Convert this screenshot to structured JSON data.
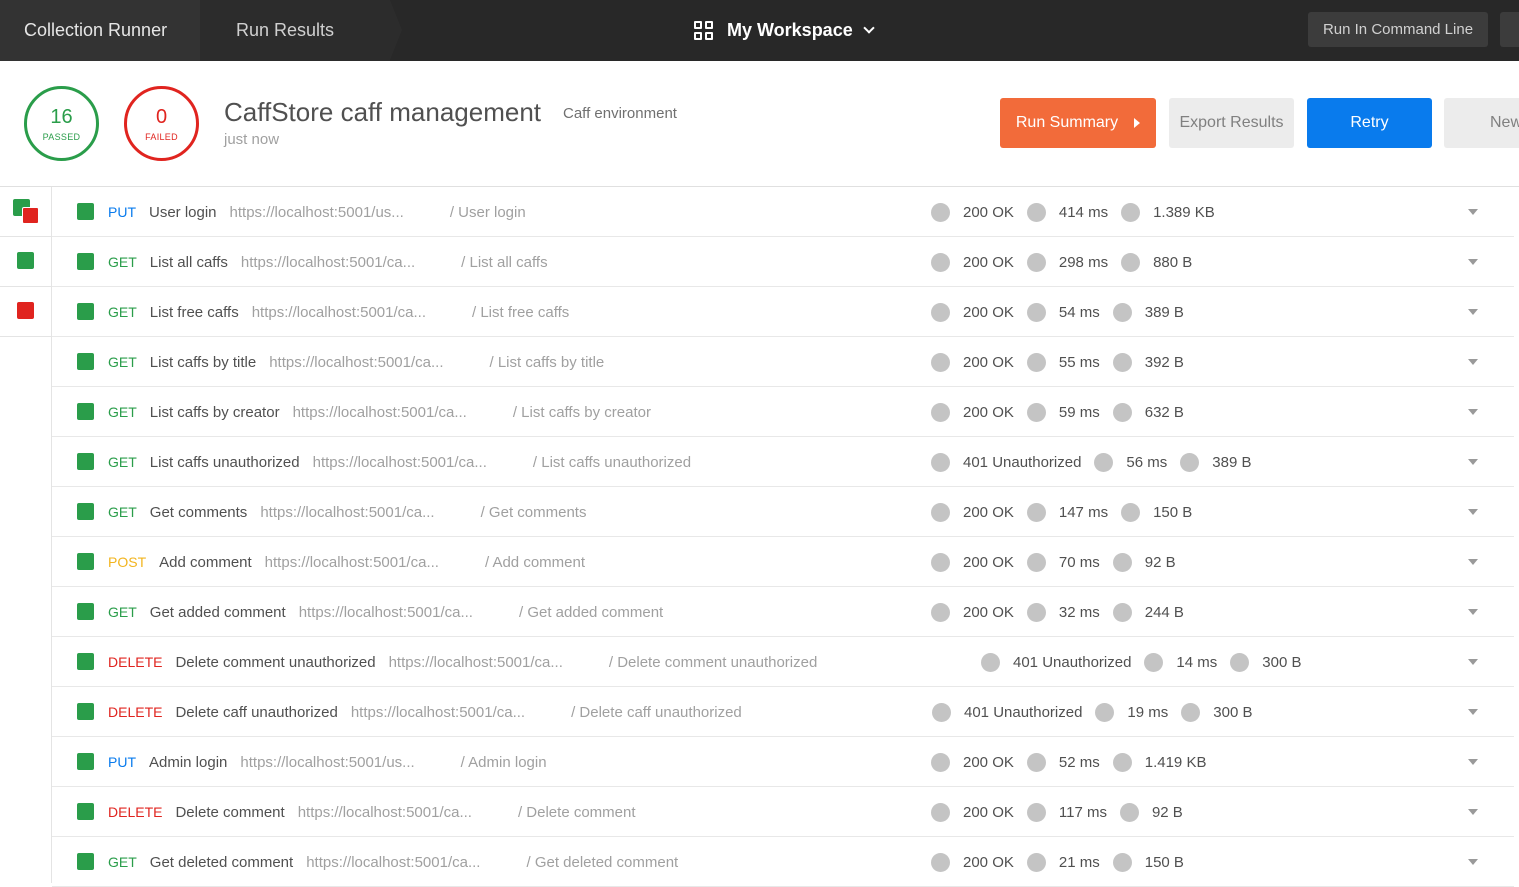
{
  "topbar": {
    "crumb_runner": "Collection Runner",
    "crumb_results": "Run Results",
    "workspace": "My Workspace",
    "run_cli": "Run In Command Line"
  },
  "summary": {
    "passed_count": "16",
    "passed_label": "PASSED",
    "failed_count": "0",
    "failed_label": "FAILED",
    "collection": "CaffStore caff management",
    "environment": "Caff environment",
    "time": "just now",
    "btn_summary": "Run Summary",
    "btn_export": "Export Results",
    "btn_retry": "Retry",
    "btn_new": "New"
  },
  "colors": {
    "pass": "#2a9d4a",
    "fail": "#e0241f",
    "accent_orange": "#f26b3a",
    "accent_blue": "#097bed"
  },
  "requests": [
    {
      "method": "PUT",
      "name": "User login",
      "url": "https://localhost:5001/us...",
      "path": "/ User login",
      "status": "200 OK",
      "time": "414 ms",
      "size": "1.389 KB"
    },
    {
      "method": "GET",
      "name": "List all caffs",
      "url": "https://localhost:5001/ca...",
      "path": "/ List all caffs",
      "status": "200 OK",
      "time": "298 ms",
      "size": "880 B"
    },
    {
      "method": "GET",
      "name": "List free caffs",
      "url": "https://localhost:5001/ca...",
      "path": "/ List free caffs",
      "status": "200 OK",
      "time": "54 ms",
      "size": "389 B"
    },
    {
      "method": "GET",
      "name": "List caffs by title",
      "url": "https://localhost:5001/ca...",
      "path": "/ List caffs by title",
      "status": "200 OK",
      "time": "55 ms",
      "size": "392 B"
    },
    {
      "method": "GET",
      "name": "List caffs by creator",
      "url": "https://localhost:5001/ca...",
      "path": "/ List caffs by creator",
      "status": "200 OK",
      "time": "59 ms",
      "size": "632 B"
    },
    {
      "method": "GET",
      "name": "List caffs unauthorized",
      "url": "https://localhost:5001/ca...",
      "path": "/ List caffs unauthorized",
      "status": "401 Unauthorized",
      "time": "56 ms",
      "size": "389 B"
    },
    {
      "method": "GET",
      "name": "Get comments",
      "url": "https://localhost:5001/ca...",
      "path": "/ Get comments",
      "status": "200 OK",
      "time": "147 ms",
      "size": "150 B"
    },
    {
      "method": "POST",
      "name": "Add comment",
      "url": "https://localhost:5001/ca...",
      "path": "/ Add comment",
      "status": "200 OK",
      "time": "70 ms",
      "size": "92 B"
    },
    {
      "method": "GET",
      "name": "Get added comment",
      "url": "https://localhost:5001/ca...",
      "path": "/ Get added comment",
      "status": "200 OK",
      "time": "32 ms",
      "size": "244 B"
    },
    {
      "method": "DELETE",
      "name": "Delete comment unauthorized",
      "url": "https://localhost:5001/ca...",
      "path": "/ Delete comment unauthorized",
      "status": "401 Unauthorized",
      "time": "14 ms",
      "size": "300 B"
    },
    {
      "method": "DELETE",
      "name": "Delete caff unauthorized",
      "url": "https://localhost:5001/ca...",
      "path": "/ Delete caff unauthorized",
      "status": "401 Unauthorized",
      "time": "19 ms",
      "size": "300 B"
    },
    {
      "method": "PUT",
      "name": "Admin login",
      "url": "https://localhost:5001/us...",
      "path": "/ Admin login",
      "status": "200 OK",
      "time": "52 ms",
      "size": "1.419 KB"
    },
    {
      "method": "DELETE",
      "name": "Delete comment",
      "url": "https://localhost:5001/ca...",
      "path": "/ Delete comment",
      "status": "200 OK",
      "time": "117 ms",
      "size": "92 B"
    },
    {
      "method": "GET",
      "name": "Get deleted comment",
      "url": "https://localhost:5001/ca...",
      "path": "/ Get deleted comment",
      "status": "200 OK",
      "time": "21 ms",
      "size": "150 B"
    }
  ]
}
